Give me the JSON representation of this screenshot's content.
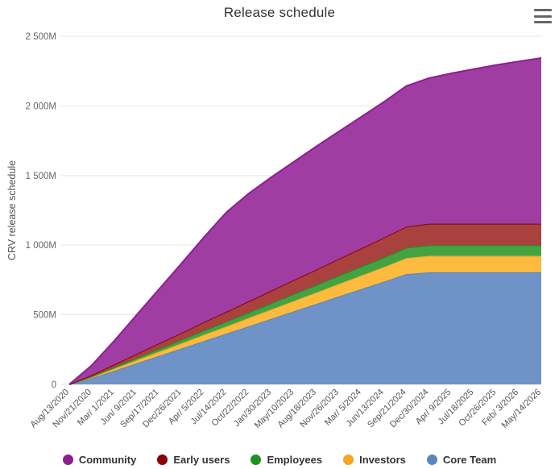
{
  "header": {
    "title": "Release schedule",
    "menu_icon": "hamburger-menu-icon"
  },
  "chart_data": {
    "type": "area",
    "stacked": true,
    "title": "Release schedule",
    "xlabel": "",
    "ylabel": "CRV release schedule",
    "ylim": [
      0,
      2500
    ],
    "yticks": [
      0,
      500,
      1000,
      1500,
      2000,
      2500
    ],
    "ytick_labels": [
      "0",
      "500M",
      "1 000M",
      "1 500M",
      "2 000M",
      "2 500M"
    ],
    "grid": true,
    "legend_position": "bottom",
    "units": "millions of CRV",
    "categories": [
      "Aug/13/2020",
      "Nov/21/2020",
      "Mar/ 1/2021",
      "Jun/ 9/2021",
      "Sep/17/2021",
      "Dec/26/2021",
      "Apr/ 5/2022",
      "Jul/14/2022",
      "Oct/22/2022",
      "Jan/30/2023",
      "May/10/2023",
      "Aug/18/2023",
      "Nov/26/2023",
      "Mar/ 5/2024",
      "Jun/13/2024",
      "Sep/21/2024",
      "Dec/30/2024",
      "Apr/ 9/2025",
      "Jul/18/2025",
      "Oct/26/2025",
      "Feb/ 3/2026",
      "May/14/2026"
    ],
    "series": [
      {
        "name": "Core Team",
        "color": "#5887c0",
        "fill": "#6f93c6",
        "values": [
          0,
          45,
          98,
          152,
          205,
          258,
          312,
          365,
          418,
          472,
          525,
          578,
          632,
          685,
          738,
          792,
          805,
          805,
          805,
          805,
          805,
          805
        ]
      },
      {
        "name": "Investors",
        "color": "#f5a623",
        "fill": "#fcbb3e",
        "values": [
          0,
          7,
          15,
          22,
          30,
          37,
          45,
          52,
          60,
          67,
          75,
          82,
          90,
          97,
          105,
          115,
          118,
          118,
          118,
          118,
          118,
          118
        ]
      },
      {
        "name": "Employees",
        "color": "#1f9122",
        "fill": "#43a343",
        "values": [
          0,
          5,
          10,
          15,
          20,
          25,
          30,
          34,
          39,
          44,
          49,
          54,
          59,
          64,
          69,
          74,
          76,
          76,
          76,
          76,
          76,
          76
        ]
      },
      {
        "name": "Early users",
        "color": "#8b0000",
        "fill": "#a9423f",
        "values": [
          0,
          10,
          20,
          30,
          40,
          50,
          61,
          71,
          81,
          91,
          101,
          111,
          121,
          131,
          142,
          152,
          155,
          155,
          155,
          155,
          155,
          155
        ]
      },
      {
        "name": "Community",
        "color": "#8e1f8e",
        "fill": "#a03da3",
        "values": [
          0,
          70,
          170,
          280,
          390,
          500,
          610,
          715,
          775,
          815,
          850,
          885,
          915,
          945,
          975,
          1010,
          1045,
          1080,
          1110,
          1140,
          1165,
          1190
        ]
      }
    ],
    "legend_order": [
      "Community",
      "Early users",
      "Employees",
      "Investors",
      "Core Team"
    ]
  },
  "legend": {
    "items": [
      {
        "label": "Community",
        "color": "#8e1f8e"
      },
      {
        "label": "Early users",
        "color": "#8b0000"
      },
      {
        "label": "Employees",
        "color": "#1f9122"
      },
      {
        "label": "Investors",
        "color": "#f5a623"
      },
      {
        "label": "Core Team",
        "color": "#5887c0"
      }
    ]
  }
}
